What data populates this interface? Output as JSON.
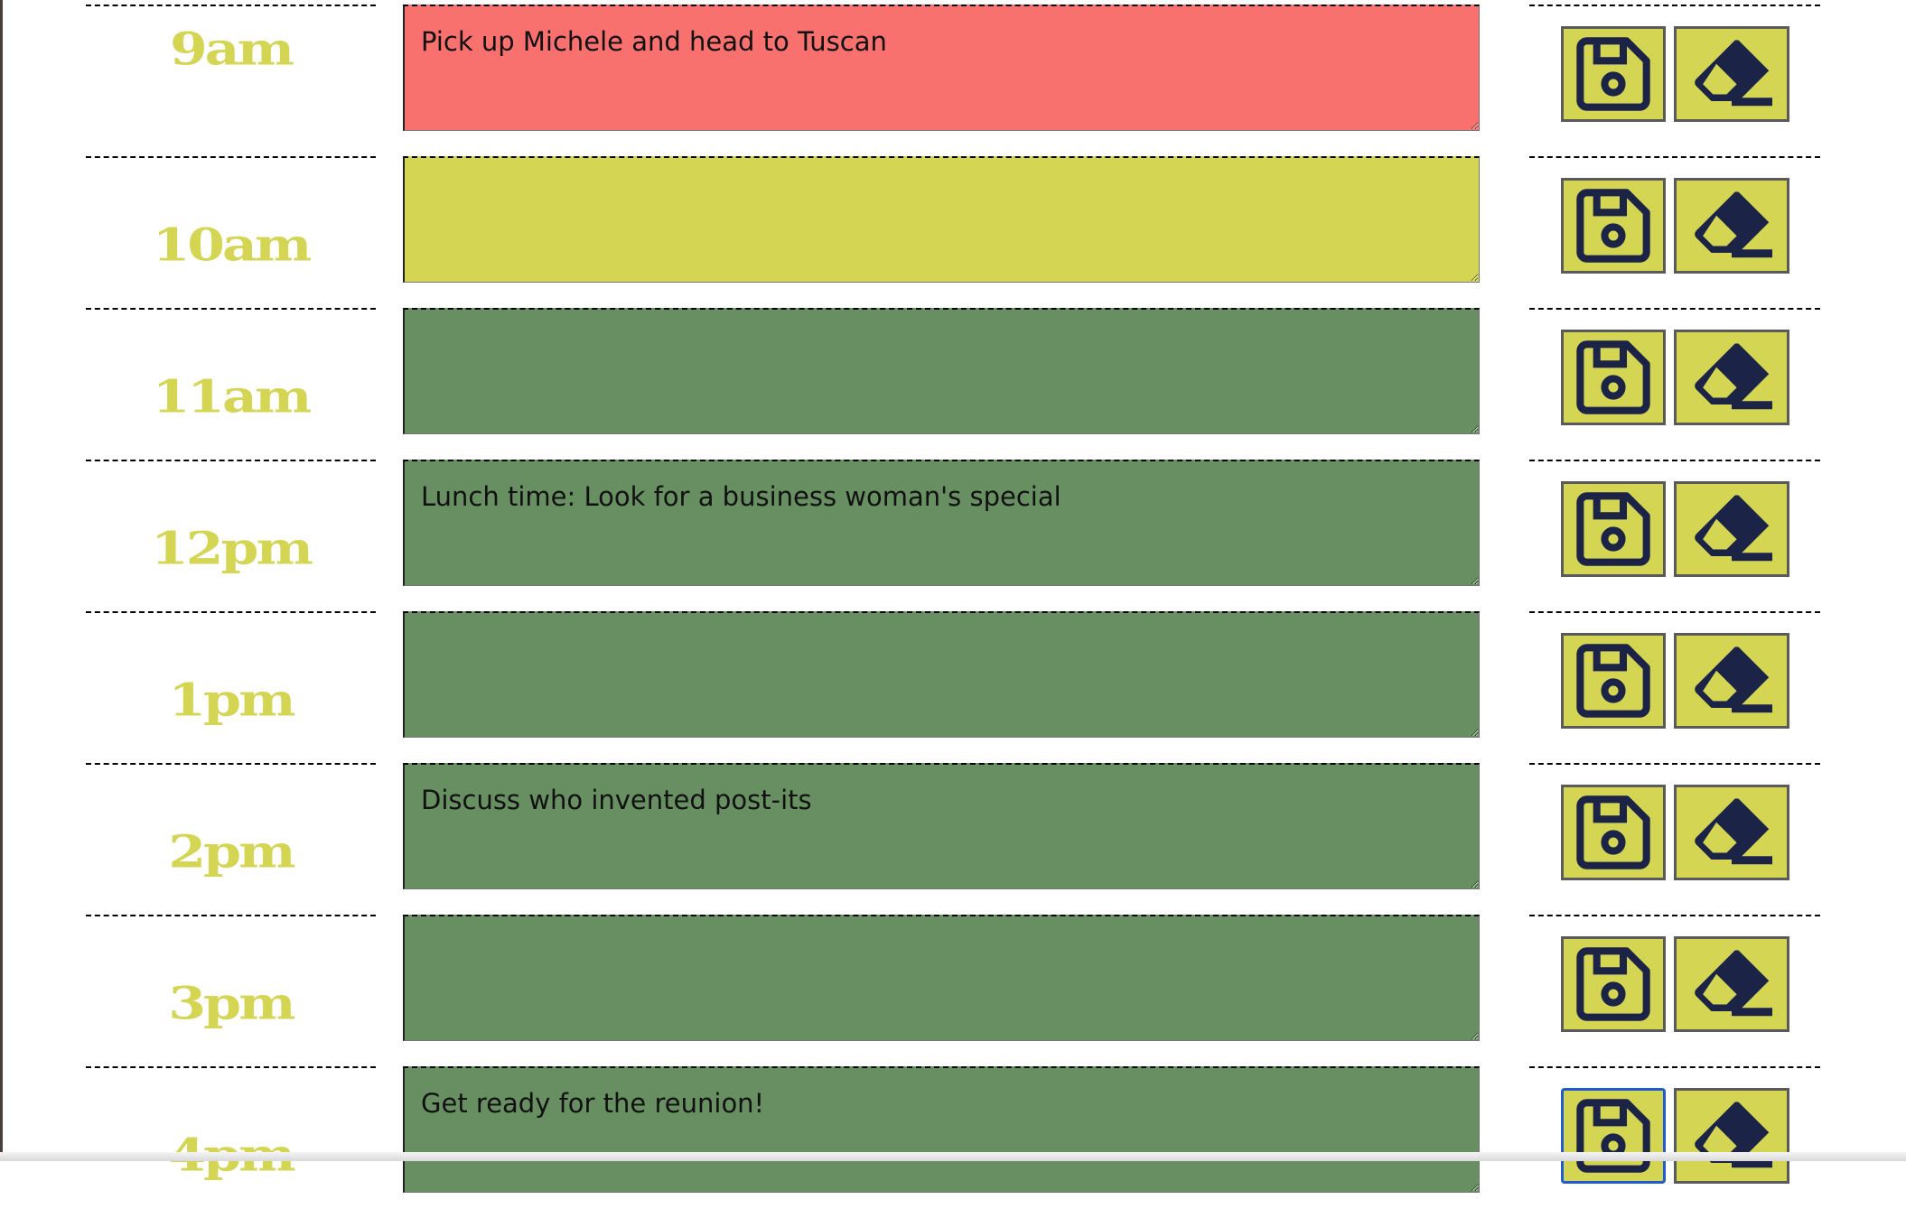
{
  "colors": {
    "past": "#f8716e",
    "present": "#d4d653",
    "future": "#688f62",
    "hour_text": "#d4d653",
    "icon": "#1b2346"
  },
  "icons": {
    "save": "floppy-disk-icon",
    "clear": "eraser-icon"
  },
  "rows": [
    {
      "hour": "9am",
      "text": "Pick up Michele and head to Tuscan",
      "state": "past"
    },
    {
      "hour": "10am",
      "text": "",
      "state": "present"
    },
    {
      "hour": "11am",
      "text": "",
      "state": "future"
    },
    {
      "hour": "12pm",
      "text": "Lunch time: Look for a business woman's special",
      "state": "future"
    },
    {
      "hour": "1pm",
      "text": "",
      "state": "future"
    },
    {
      "hour": "2pm",
      "text": "Discuss who invented post-its",
      "state": "future"
    },
    {
      "hour": "3pm",
      "text": "",
      "state": "future"
    },
    {
      "hour": "4pm",
      "text": "Get ready for the reunion!",
      "state": "future"
    }
  ]
}
